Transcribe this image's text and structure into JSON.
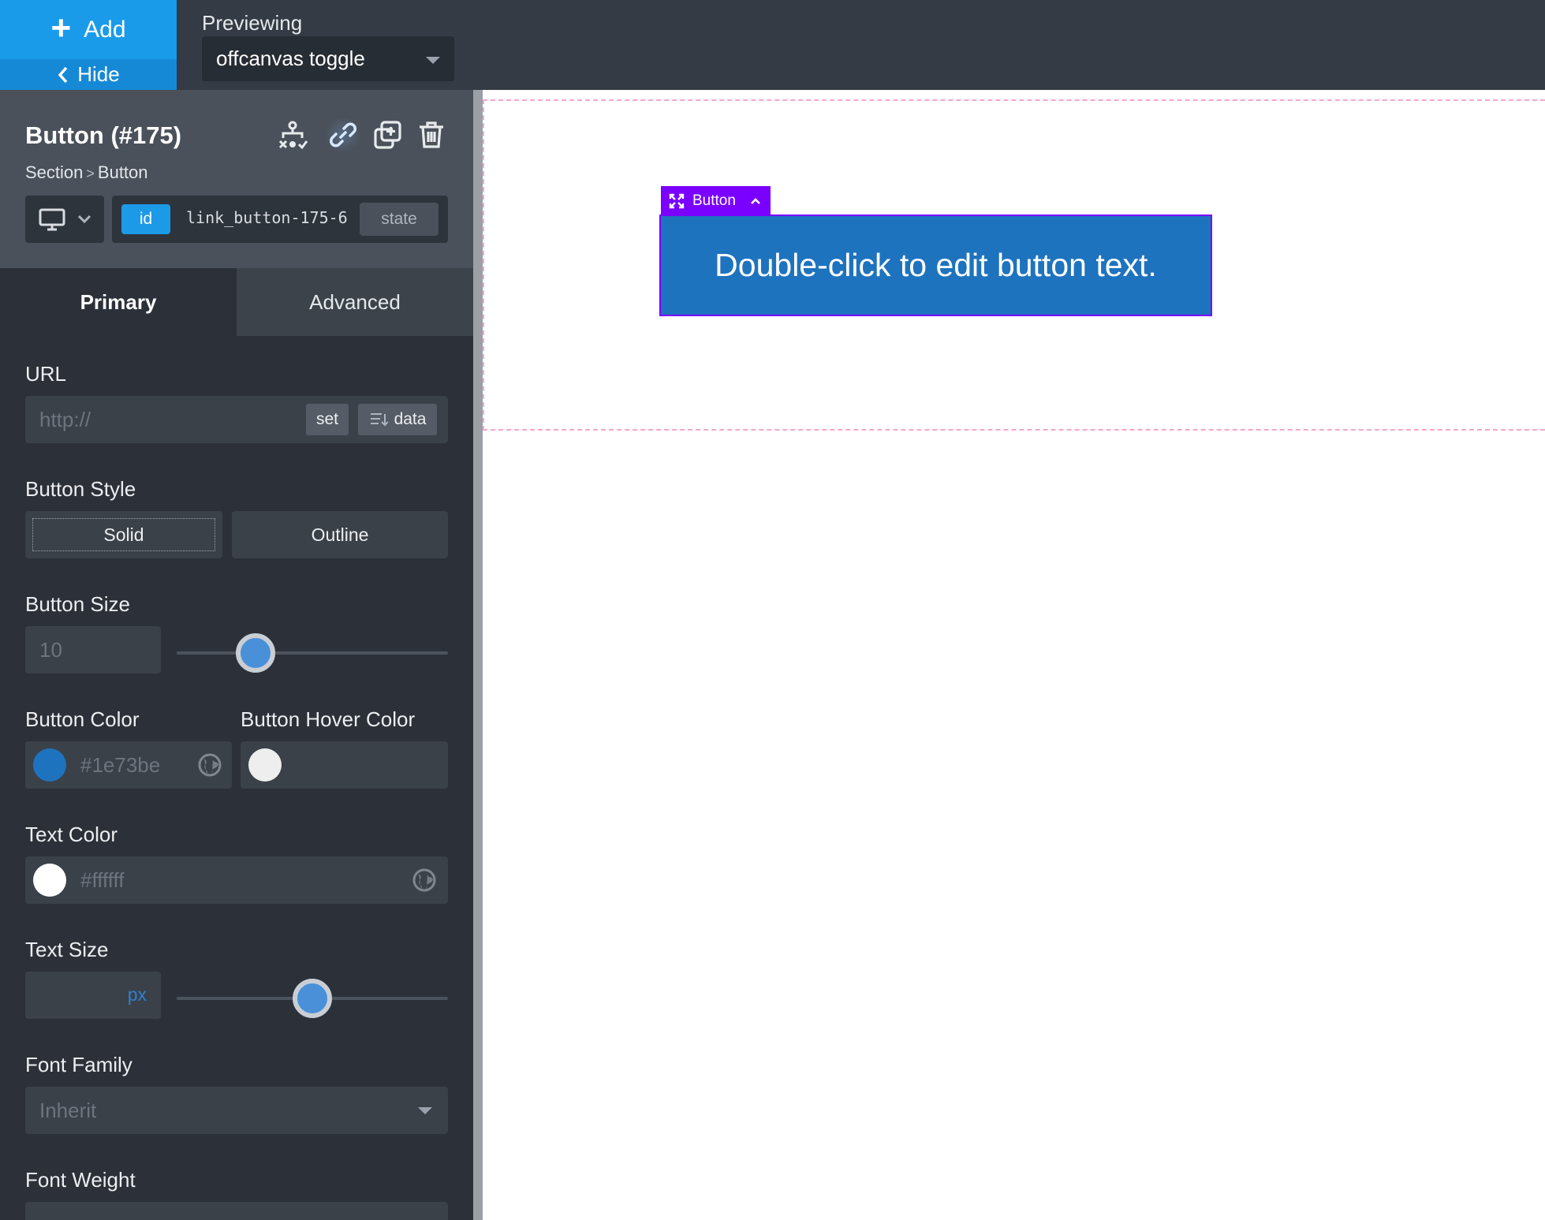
{
  "topbar": {
    "add_label": "Add",
    "hide_label": "Hide",
    "previewing_label": "Previewing",
    "preview_select_value": "offcanvas toggle"
  },
  "panel": {
    "title": "Button (#175)",
    "breadcrumb": {
      "parent": "Section",
      "separator": ">",
      "current": "Button"
    },
    "icons": [
      "structure-icon",
      "link-icon",
      "duplicate-icon",
      "trash-icon"
    ],
    "id_badge": "id",
    "id_value": "link_button-175-6",
    "state_label": "state"
  },
  "tabs": {
    "primary": "Primary",
    "advanced": "Advanced"
  },
  "fields": {
    "url": {
      "label": "URL",
      "placeholder": "http://",
      "set_label": "set",
      "data_label": "data"
    },
    "button_style": {
      "label": "Button Style",
      "options": [
        "Solid",
        "Outline"
      ],
      "selected": "Solid"
    },
    "button_size": {
      "label": "Button Size",
      "value": "10",
      "slider_percent": 29
    },
    "button_color": {
      "label": "Button Color",
      "value": "#1e73be",
      "swatch": "#1e73be"
    },
    "button_hover_color": {
      "label": "Button Hover Color",
      "value": "",
      "swatch": "#eeeeee"
    },
    "text_color": {
      "label": "Text Color",
      "value": "#ffffff",
      "swatch": "#ffffff"
    },
    "text_size": {
      "label": "Text Size",
      "unit": "px",
      "slider_percent": 50
    },
    "font_family": {
      "label": "Font Family",
      "value": "Inherit"
    },
    "font_weight": {
      "label": "Font Weight"
    }
  },
  "canvas": {
    "element_tag": "Button",
    "button_text": "Double-click to edit button text.",
    "button_bg": "#1e73be",
    "selection_color": "#7a00ff",
    "section_outline_color": "#f6a5cd"
  }
}
